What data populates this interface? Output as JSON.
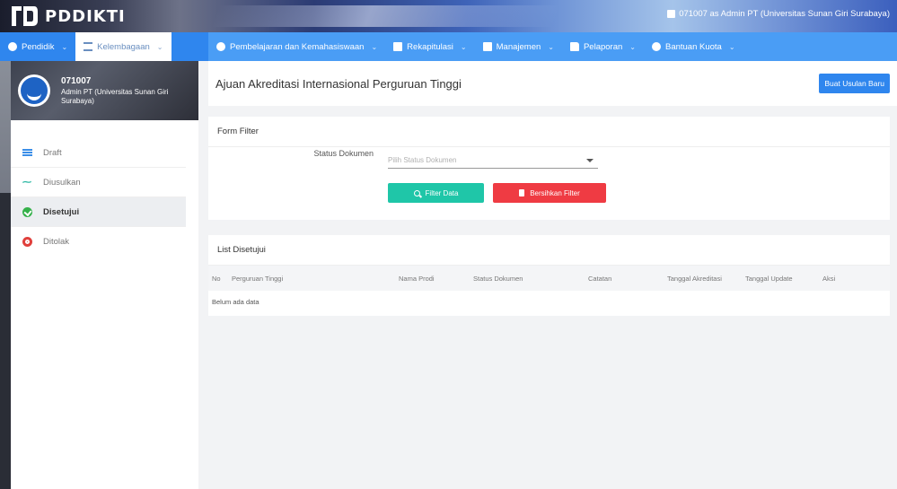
{
  "header": {
    "logo_text": "PDDIKTI",
    "user_info": "071007 as Admin PT (Universitas Sunan Giri Surabaya)"
  },
  "nav": {
    "left_items": [
      {
        "label": "Pendidik",
        "icon": "user-circle-icon"
      },
      {
        "label": "Kelembagaan",
        "icon": "institution-icon"
      }
    ],
    "right_items": [
      {
        "label": "Pembelajaran dan Kemahasiswaan",
        "icon": "user-circle-icon"
      },
      {
        "label": "Rekapitulasi",
        "icon": "calendar-icon"
      },
      {
        "label": "Manajemen",
        "icon": "document-icon"
      },
      {
        "label": "Pelaporan",
        "icon": "folder-icon"
      },
      {
        "label": "Bantuan Kuota",
        "icon": "user-circle-icon"
      }
    ]
  },
  "profile": {
    "id": "071007",
    "role": "Admin PT (Universitas Sunan Giri Surabaya)"
  },
  "sidebar": {
    "items": [
      {
        "label": "Draft",
        "icon": "list-icon"
      },
      {
        "label": "Diusulkan",
        "icon": "trend-icon"
      },
      {
        "label": "Disetujui",
        "icon": "check-circle-icon"
      },
      {
        "label": "Ditolak",
        "icon": "x-circle-icon"
      }
    ]
  },
  "page": {
    "title": "Ajuan Akreditasi Internasional Perguruan Tinggi",
    "new_button": "Buat Usulan Baru"
  },
  "filter": {
    "title": "Form Filter",
    "status_label": "Status Dokumen",
    "status_placeholder": "Pilih Status Dokumen",
    "filter_button": "Filter Data",
    "clear_button": "Bersihkan Filter"
  },
  "list": {
    "title": "List Disetujui",
    "columns": [
      "No",
      "Perguruan Tinggi",
      "Nama Prodi",
      "Status Dokumen",
      "Catatan",
      "Tanggal Akreditasi",
      "Tanggal Update",
      "Aksi"
    ],
    "empty_text": "Belum ada data"
  }
}
